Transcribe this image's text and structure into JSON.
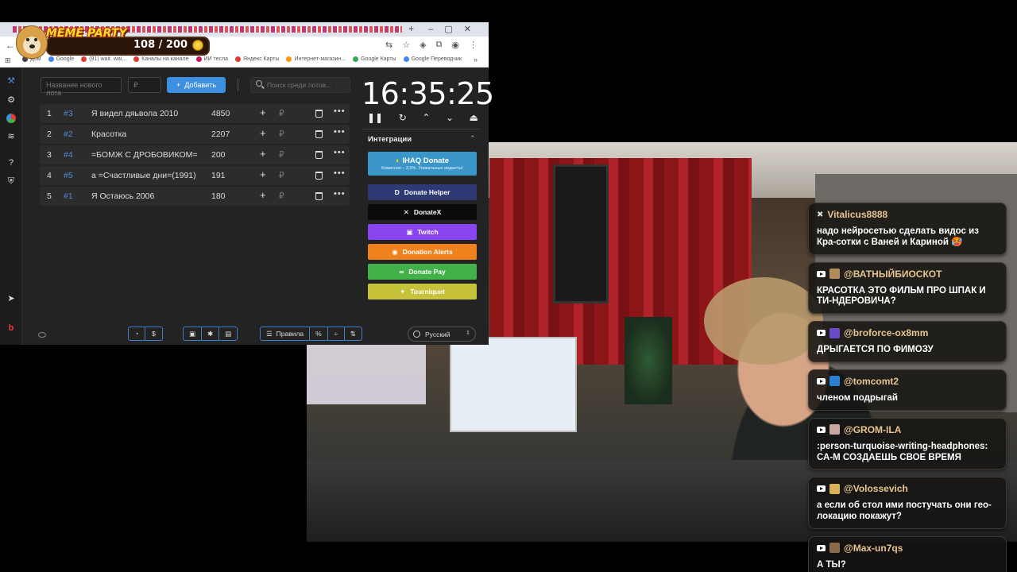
{
  "overlay": {
    "counter": "108 / 200",
    "logo_title": "MEME PARTY"
  },
  "browser": {
    "new_tab": "+",
    "bookmarks": [
      {
        "label": "Дом",
        "color": "#444444"
      },
      {
        "label": "Google",
        "color": "#4285f4"
      },
      {
        "label": "(91) wait. wai...",
        "color": "#e53935"
      },
      {
        "label": "Каналы на канале",
        "color": "#e53935"
      },
      {
        "label": "ИИ тесла",
        "color": "#c2185b"
      },
      {
        "label": "Яндекс Карты",
        "color": "#e53935"
      },
      {
        "label": "Интернет-магазин...",
        "color": "#ff9800"
      },
      {
        "label": "Google Карты",
        "color": "#34a853"
      },
      {
        "label": "Google Переводчик",
        "color": "#4285f4"
      }
    ]
  },
  "app": {
    "new_lot_placeholder": "Название нового лота",
    "currency_placeholder": "₽",
    "add_button": "Добавить",
    "search_placeholder": "Поиск среди лотов...",
    "lots": [
      {
        "index": "1",
        "id": "#3",
        "name": "Я видел дяьвола 2010",
        "value": "4850"
      },
      {
        "index": "2",
        "id": "#2",
        "name": "Красотка",
        "value": "2207"
      },
      {
        "index": "3",
        "id": "#4",
        "name": "=БОМЖ С ДРОБОВИКОМ=",
        "value": "200"
      },
      {
        "index": "4",
        "id": "#5",
        "name": "а =Счастливые дни=(1991)",
        "value": "191"
      },
      {
        "index": "5",
        "id": "#1",
        "name": "Я Остаюсь 2006",
        "value": "180"
      }
    ],
    "currency_symbol": "₽",
    "timer": "16:35:25",
    "integrations_title": "Интеграции",
    "integrations": [
      {
        "label": "IHAQ Donate",
        "sub": "Комиссия – 3,5%. Уникальные виджеты!",
        "color": "#3a95c8"
      },
      {
        "label": "Donate Helper",
        "color": "#2d3a73"
      },
      {
        "label": "DonateX",
        "color": "#0b0b0b"
      },
      {
        "label": "Twitch",
        "color": "#8a45f2"
      },
      {
        "label": "Donation Alerts",
        "color": "#f0821e"
      },
      {
        "label": "Donate Pay",
        "color": "#43b14a"
      },
      {
        "label": "Tourniquet",
        "color": "#c6c33a"
      }
    ],
    "footer": {
      "rules": "Правила",
      "percent": "%",
      "language": "Русский"
    }
  },
  "chat": [
    {
      "user": "Vitalicus8888",
      "text": "надо нейросетью сделать видос из Кра-сотки с Ваней и Кариной 🥵",
      "avatar": "#777777",
      "platform": "x"
    },
    {
      "user": "@ВАТНЫЙБИОСКОТ",
      "text": "КРАСОТКА ЭТО ФИЛЬМ ПРО ШПАК И ТИ-НДЕРОВИЧА?",
      "avatar": "#b38a5a",
      "platform": "youtube"
    },
    {
      "user": "@broforce-ox8mm",
      "text": "ДРЫГАЕТСЯ ПО ФИМОЗУ",
      "avatar": "#6a4bc8",
      "platform": "youtube"
    },
    {
      "user": "@tomcomt2",
      "text": "членом подрыгай",
      "avatar": "#2a7fd1",
      "platform": "youtube"
    },
    {
      "user": "@GROM-ILA",
      "text": ":person-turquoise-writing-headphones: СА-М СОЗДАЕШЬ СВОЕ ВРЕМЯ",
      "avatar": "#c9a7a0",
      "platform": "youtube"
    },
    {
      "user": "@Volossevich",
      "text": "а если об стол ими постучать они гео-локацию покажут?",
      "avatar": "#d9b25a",
      "platform": "youtube"
    },
    {
      "user": "@Max-un7qs",
      "text": "А ТЫ?",
      "avatar": "#8a6a4a",
      "platform": "youtube"
    }
  ]
}
